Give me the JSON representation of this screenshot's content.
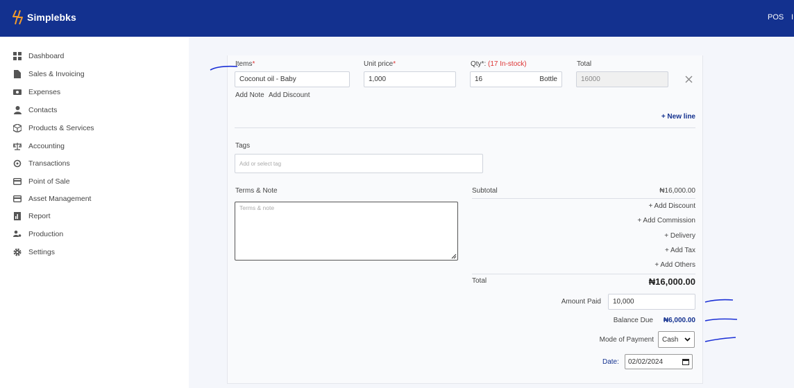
{
  "app": {
    "name": "Simplebks",
    "brand_color": "#13318f",
    "top_right": [
      "POS",
      "I"
    ]
  },
  "sidebar": {
    "items": [
      {
        "label": "Dashboard",
        "icon": "grid-icon"
      },
      {
        "label": "Sales & Invoicing",
        "icon": "file-icon"
      },
      {
        "label": "Expenses",
        "icon": "wallet-icon"
      },
      {
        "label": "Contacts",
        "icon": "user-icon"
      },
      {
        "label": "Products & Services",
        "icon": "box-icon"
      },
      {
        "label": "Accounting",
        "icon": "scale-icon"
      },
      {
        "label": "Transactions",
        "icon": "refresh-icon"
      },
      {
        "label": "Point of Sale",
        "icon": "card-icon"
      },
      {
        "label": "Asset Management",
        "icon": "card-icon"
      },
      {
        "label": "Report",
        "icon": "report-icon"
      },
      {
        "label": "Production",
        "icon": "people-icon"
      },
      {
        "label": "Settings",
        "icon": "gear-icon"
      }
    ]
  },
  "line_item": {
    "items_label": "Items",
    "items_req": "*",
    "item_value": "Coconut oil - Baby",
    "unit_price_label": "Unit price",
    "unit_price_req": "*",
    "unit_price_value": "1,000",
    "qty_label": "Qty*:",
    "qty_stock": "(17 In-stock)",
    "qty_value": "16",
    "qty_unit": "Bottle",
    "total_label": "Total",
    "total_value": "16000",
    "add_note": "Add Note",
    "add_discount": "Add Discount",
    "new_line": "+ New line"
  },
  "tags": {
    "label": "Tags",
    "placeholder": "Add or select tag"
  },
  "terms": {
    "label": "Terms & Note",
    "placeholder": "Terms & note"
  },
  "summary": {
    "subtotal_label": "Subtotal",
    "subtotal_value": "₦16,000.00",
    "add_discount": "+ Add Discount",
    "add_commission": "+ Add Commission",
    "delivery": "+ Delivery",
    "add_tax": "+ Add Tax",
    "add_others": "+ Add Others",
    "total_label": "Total",
    "total_value": "₦16,000.00",
    "amount_paid_label": "Amount Paid",
    "amount_paid_value": "10,000",
    "balance_due_label": "Balance Due",
    "balance_due_value": "₦6,000.00",
    "mode_label": "Mode of Payment",
    "mode_value": "Cash",
    "date_label": "Date:",
    "date_value": "02/02/2024"
  }
}
